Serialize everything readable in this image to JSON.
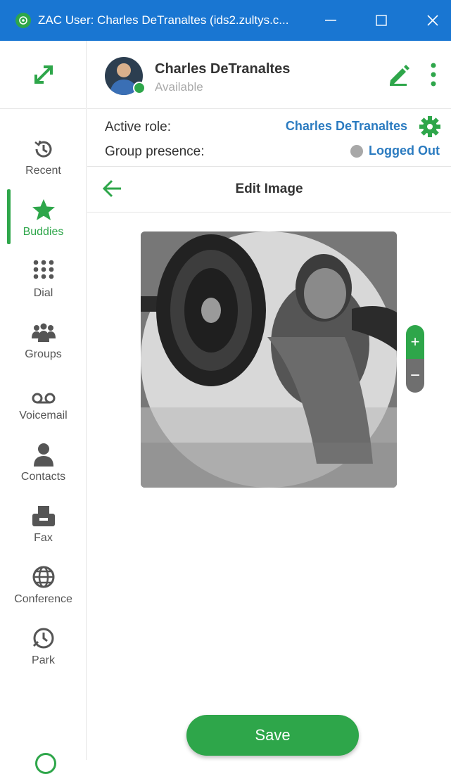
{
  "window": {
    "title": "ZAC User: Charles DeTranaltes (ids2.zultys.c...",
    "minimize_glyph": "—",
    "maximize_glyph": "☐",
    "close_glyph": "✕",
    "icon": "zac-app-icon"
  },
  "user": {
    "name": "Charles DeTranaltes",
    "status": "Available"
  },
  "role": {
    "active_role_label": "Active role:",
    "active_role_value": "Charles DeTranaltes",
    "group_presence_label": "Group presence:",
    "group_presence_value": "Logged Out"
  },
  "edit_bar": {
    "title": "Edit Image"
  },
  "sidebar": {
    "items": [
      {
        "label": "Recent",
        "icon": "history-icon"
      },
      {
        "label": "Buddies",
        "icon": "star-icon",
        "active": true
      },
      {
        "label": "Dial",
        "icon": "dialpad-icon"
      },
      {
        "label": "Groups",
        "icon": "groups-icon"
      },
      {
        "label": "Voicemail",
        "icon": "voicemail-icon"
      },
      {
        "label": "Contacts",
        "icon": "contact-icon"
      },
      {
        "label": "Fax",
        "icon": "fax-icon"
      },
      {
        "label": "Conference",
        "icon": "globe-icon"
      },
      {
        "label": "Park",
        "icon": "park-icon"
      }
    ]
  },
  "zoom": {
    "in_glyph": "+",
    "out_glyph": "−"
  },
  "actions": {
    "save_label": "Save"
  },
  "colors": {
    "titlebar": "#1976d2",
    "accent_green": "#2ea64a",
    "link_blue": "#2b7bc0",
    "offline_grey": "#a8a8a8"
  }
}
